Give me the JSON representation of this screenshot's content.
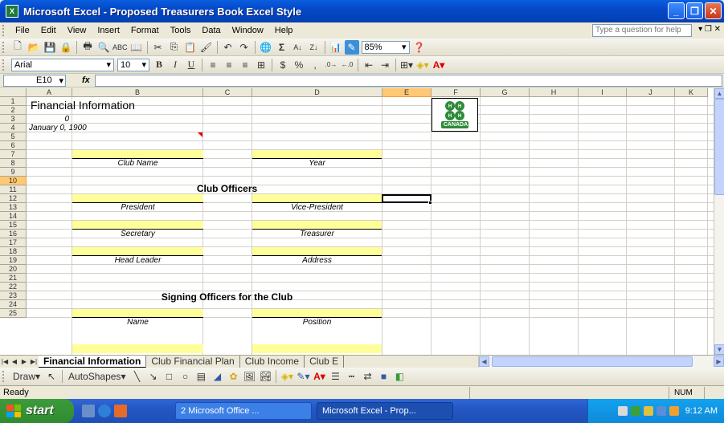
{
  "window": {
    "title": "Microsoft Excel - Proposed Treasurers Book Excel Style",
    "app_icon": "excel-icon"
  },
  "menus": [
    "File",
    "Edit",
    "View",
    "Insert",
    "Format",
    "Tools",
    "Data",
    "Window",
    "Help"
  ],
  "help_box": {
    "placeholder": "Type a question for help"
  },
  "standard_toolbar": {
    "zoom": "85%"
  },
  "formatting_toolbar": {
    "font": "Arial",
    "size": "10",
    "bold": "B",
    "italic": "I",
    "underline": "U",
    "currency": "$",
    "percent": "%",
    "comma": ","
  },
  "formula_bar": {
    "name_box": "E10",
    "fx": "fx",
    "content": ""
  },
  "columns": [
    "A",
    "B",
    "C",
    "D",
    "E",
    "F",
    "G",
    "H",
    "I",
    "J",
    "K"
  ],
  "rows": [
    "1",
    "2",
    "3",
    "4",
    "5",
    "6",
    "7",
    "8",
    "9",
    "10",
    "11",
    "12",
    "13",
    "14",
    "15",
    "16",
    "17",
    "18",
    "19",
    "20",
    "21",
    "22",
    "23",
    "24",
    "25"
  ],
  "sheet": {
    "a1": "Financial Information",
    "a2": "0",
    "a3": "January 0, 1900",
    "club_name": "Club Name",
    "year": "Year",
    "club_officers": "Club Officers",
    "president": "President",
    "vice_president": "Vice-President",
    "secretary": "Secretary",
    "treasurer": "Treasurer",
    "head_leader": "Head Leader",
    "address": "Address",
    "signing_officers": "Signing Officers for the Club",
    "name": "Name",
    "position": "Position",
    "logo_caption": "CANADA"
  },
  "tabs": [
    "Financial Information",
    "Club Financial Plan",
    "Club Income",
    "Club E"
  ],
  "drawing_toolbar": {
    "draw": "Draw",
    "autoshapes": "AutoShapes"
  },
  "status": {
    "left": "Ready",
    "num": "NUM"
  },
  "taskbar": {
    "start": "start",
    "task1": "2 Microsoft Office ...",
    "task2": "Microsoft Excel - Prop...",
    "clock": "9:12 AM"
  },
  "colors": {
    "title_blue": "#0548c8",
    "cell_yellow": "#ffff99",
    "selected_header": "#ffc873",
    "clover_green": "#2e8b3a",
    "start_green": "#3c9b3c"
  }
}
